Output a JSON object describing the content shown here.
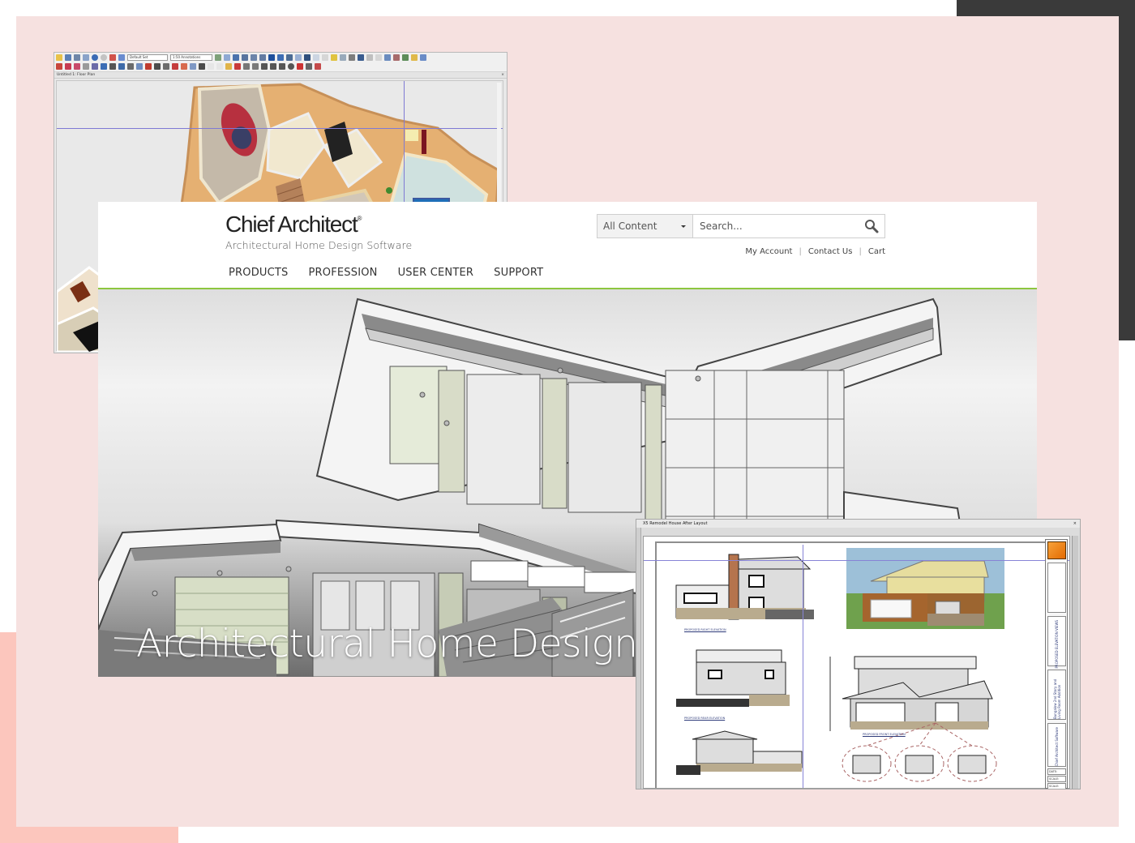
{
  "colors": {
    "background_pink": "#f6e1e0",
    "accent_dark": "#3a3a3a",
    "accent_salmon": "#fcc6bd",
    "nav_underline": "#8dc63f"
  },
  "floor_plan_window": {
    "toolbar": {
      "layer_set": "Default Set",
      "annotation_set": "1:50 Annotations"
    },
    "view_title": "Untitled 1: Floor Plan",
    "close_glyph": "×"
  },
  "website": {
    "brand": {
      "name": "Chief Architect",
      "registered": "®",
      "tagline": "Architectural Home Design Software"
    },
    "search": {
      "scope": "All Content",
      "placeholder": "Search...",
      "icon": "search-icon"
    },
    "utility_links": [
      "My Account",
      "Contact Us",
      "Cart"
    ],
    "nav": [
      "PRODUCTS",
      "PROFESSION",
      "USER CENTER",
      "SUPPORT"
    ],
    "hero": {
      "title": "Architectural Home Design"
    }
  },
  "layout_window": {
    "title": "X5 Remodel House After Layout",
    "close_glyph": "×",
    "captions": {
      "right": "PROPOSED RIGHT ELEVATION",
      "rear": "PROPOSED REAR ELEVATION",
      "front": "PROPOSED FRONT ELEVATION"
    },
    "title_block": {
      "sheet_title": "PROPOSED ELEVATION VIEWS",
      "project": "Bungalow 2nd Story and Living Room Addition",
      "company": "Chief Architect Software",
      "fields": [
        "DATE:",
        "SCALE:",
        "SCALE:"
      ]
    }
  }
}
